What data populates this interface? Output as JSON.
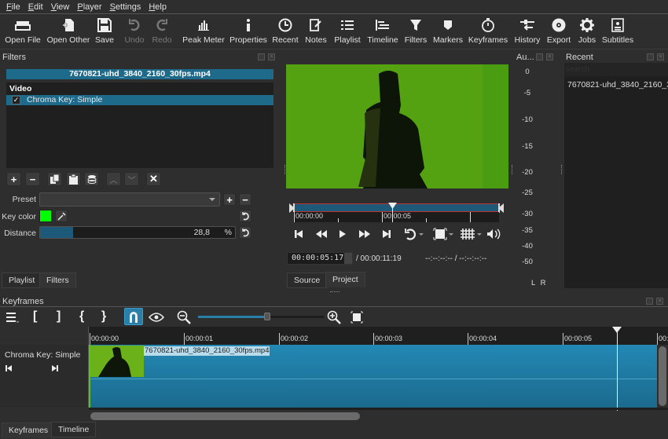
{
  "menu": [
    "File",
    "Edit",
    "View",
    "Player",
    "Settings",
    "Help"
  ],
  "toolbar": [
    {
      "id": "open-file",
      "label": "Open File",
      "icon": "folder-icon"
    },
    {
      "id": "open-other",
      "label": "Open Other",
      "icon": "open-other-icon"
    },
    {
      "id": "save",
      "label": "Save",
      "icon": "save-icon"
    },
    {
      "id": "undo",
      "label": "Undo",
      "icon": "undo-icon",
      "disabled": true
    },
    {
      "id": "redo",
      "label": "Redo",
      "icon": "redo-icon",
      "disabled": true
    },
    {
      "id": "peak-meter",
      "label": "Peak Meter",
      "icon": "peak-meter-icon"
    },
    {
      "id": "properties",
      "label": "Properties",
      "icon": "info-icon"
    },
    {
      "id": "recent",
      "label": "Recent",
      "icon": "clock-icon"
    },
    {
      "id": "notes",
      "label": "Notes",
      "icon": "notes-icon"
    },
    {
      "id": "playlist",
      "label": "Playlist",
      "icon": "list-icon"
    },
    {
      "id": "timeline",
      "label": "Timeline",
      "icon": "timeline-icon"
    },
    {
      "id": "filters",
      "label": "Filters",
      "icon": "funnel-icon"
    },
    {
      "id": "markers",
      "label": "Markers",
      "icon": "marker-icon"
    },
    {
      "id": "keyframes",
      "label": "Keyframes",
      "icon": "stopwatch-icon"
    },
    {
      "id": "history",
      "label": "History",
      "icon": "history-icon"
    },
    {
      "id": "export",
      "label": "Export",
      "icon": "disc-icon"
    },
    {
      "id": "jobs",
      "label": "Jobs",
      "icon": "gear-icon"
    },
    {
      "id": "subtitles",
      "label": "Subtitles",
      "icon": "subtitles-icon"
    }
  ],
  "filters": {
    "title": "Filters",
    "clip_name": "7670821-uhd_3840_2160_30fps.mp4",
    "section": "Video",
    "items": [
      {
        "label": "Chroma Key: Simple",
        "checked": true
      }
    ],
    "preset_label": "Preset",
    "preset_value": "",
    "key_color_label": "Key color",
    "key_color": "#00ff00",
    "distance_label": "Distance",
    "distance_value": "28,8",
    "distance_unit": "%",
    "distance_fraction": 0.288
  },
  "left_tabs": [
    "Playlist",
    "Filters"
  ],
  "player": {
    "ruler_labels": [
      "00:00:00",
      "00:00:05"
    ],
    "timecode": "00:00:05:17",
    "duration": "/ 00:00:11:19",
    "in_out": "--:--:--:-- / --:--:--:--",
    "tabs": [
      "Source",
      "Project"
    ],
    "position_fraction": 0.49
  },
  "audio": {
    "title": "Au...",
    "db_labels": [
      "0",
      "-5",
      "-10",
      "-15",
      "-20",
      "-25",
      "-30",
      "-35",
      "-40",
      "-50"
    ],
    "channels": "L  R"
  },
  "recent": {
    "title": "Recent",
    "search_placeholder": "search",
    "items": [
      "7670821-uhd_3840_2160_30..."
    ]
  },
  "keyframes": {
    "title": "Keyframes",
    "ruler_labels": [
      "00:00:00",
      "00:00:01",
      "00:00:02",
      "00:00:03",
      "00:00:04",
      "00:00:05",
      "00:"
    ],
    "track_name": "Chroma Key: Simple",
    "clip_name": "7670821-uhd_3840_2160_30fps.mp4",
    "zoom_fraction": 0.55
  },
  "bottom_tabs": [
    "Keyframes",
    "Timeline"
  ]
}
